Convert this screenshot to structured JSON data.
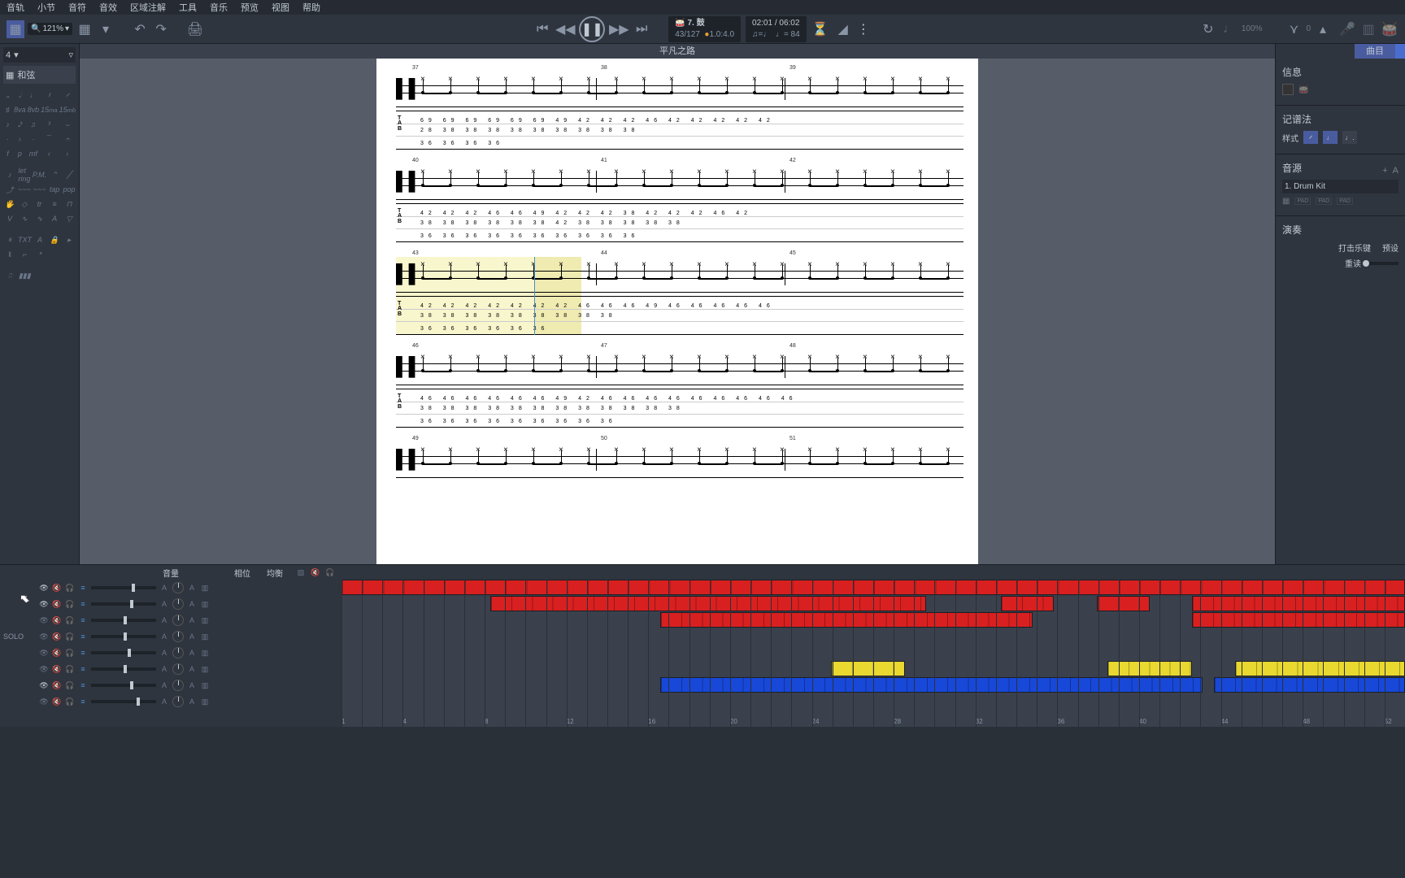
{
  "menu": {
    "items": [
      "音轨",
      "小节",
      "音符",
      "音效",
      "区域注解",
      "工具",
      "音乐",
      "预览",
      "视图",
      "帮助"
    ]
  },
  "toolbar": {
    "zoom": "121%",
    "track_info": {
      "icon": "🥁",
      "name": "7. 鼓"
    },
    "measure": "43/127",
    "tempo_sig": "1.0:4.0",
    "time": "02:01 / 06:02",
    "tempo": "= 84",
    "speed": "100%",
    "fret_val": "0"
  },
  "title": "平凡之路",
  "sidebar_left": {
    "track_num": "4",
    "chord": "和弦"
  },
  "sidebar_right": {
    "tab": "曲目",
    "info": "信息",
    "notation": "记谱法",
    "style_label": "样式",
    "source": "音源",
    "source_item": "1. Drum Kit",
    "perform": "演奏",
    "strike": "打击乐键",
    "preset": "预设",
    "reread": "重读"
  },
  "score": {
    "rows": [
      {
        "measures": [
          37,
          38,
          39
        ],
        "tab_top": "69  69  69  69  69  69      49  42      42  42      46      42      42      42  42      42",
        "tab_mid": "            28                    38  38            38      38              38      38      38              38      38",
        "tab_bot": "                                  36                    36      36          36"
      },
      {
        "measures": [
          40,
          41,
          42
        ],
        "tab_top": "42      42      42      46      46      49  42      42  42      38      42      42      42      46      42",
        "tab_mid": "    38      38      38      38      38              38      42              38      38      38      38      38",
        "tab_bot": "36      36      36      36      36      36                  36      36      36                    36"
      },
      {
        "measures": [
          43,
          44,
          45
        ],
        "highlight": true,
        "tab_top": "42      42  42              42      42      42  42      46  46      46      49  46      46      46      46      46",
        "tab_mid": "    38              38                  38                  38      38              38      38      38      38",
        "tab_bot": "36              36          36                      36                      36                      36"
      },
      {
        "measures": [
          46,
          47,
          48
        ],
        "tab_top": "46  46      46      46      46      46      49  42      46  46      46      46      46      46      46      46      46",
        "tab_mid": "        38      38      38      38      38              38      38      38              38      38      38      38",
        "tab_bot": "36      36  36              36      36      36                      36      36                      36"
      },
      {
        "measures": [
          49,
          50,
          51
        ],
        "partial": true
      }
    ]
  },
  "mixer": {
    "headers": {
      "volume": "音量",
      "pan": "相位",
      "eq": "均衡"
    },
    "solo": "SOLO",
    "tracks": [
      {
        "vol": 62,
        "visible": true
      },
      {
        "vol": 60,
        "visible": true
      },
      {
        "vol": 50,
        "visible": false
      },
      {
        "vol": 50,
        "visible": false
      },
      {
        "vol": 56,
        "visible": false
      },
      {
        "vol": 50,
        "visible": false
      },
      {
        "vol": 60,
        "visible": true
      },
      {
        "vol": 70,
        "visible": false
      }
    ],
    "ruler_marks": [
      1,
      4,
      8,
      12,
      16,
      20,
      24,
      28,
      32,
      36,
      40,
      44,
      48,
      52
    ]
  },
  "arranger": {
    "rows": [
      {
        "blocks": [
          {
            "start": 0,
            "end": 100,
            "color": "#d82020"
          }
        ]
      },
      {
        "blocks": [
          {
            "start": 14,
            "end": 55,
            "color": "#d82020"
          },
          {
            "start": 62,
            "end": 67,
            "color": "#d82020"
          },
          {
            "start": 71,
            "end": 76,
            "color": "#d82020"
          },
          {
            "start": 80,
            "end": 100,
            "color": "#d82020"
          }
        ]
      },
      {
        "blocks": [
          {
            "start": 30,
            "end": 65,
            "color": "#d82020"
          },
          {
            "start": 80,
            "end": 100,
            "color": "#d82020"
          }
        ]
      },
      {
        "blocks": []
      },
      {
        "blocks": []
      },
      {
        "blocks": [
          {
            "start": 46,
            "end": 53,
            "color": "#e8d830"
          },
          {
            "start": 72,
            "end": 80,
            "color": "#e8d830"
          },
          {
            "start": 84,
            "end": 100,
            "color": "#e8d830"
          }
        ]
      },
      {
        "blocks": [
          {
            "start": 30,
            "end": 81,
            "color": "#1848d8"
          },
          {
            "start": 82,
            "end": 100,
            "color": "#1848d8"
          }
        ]
      }
    ]
  }
}
